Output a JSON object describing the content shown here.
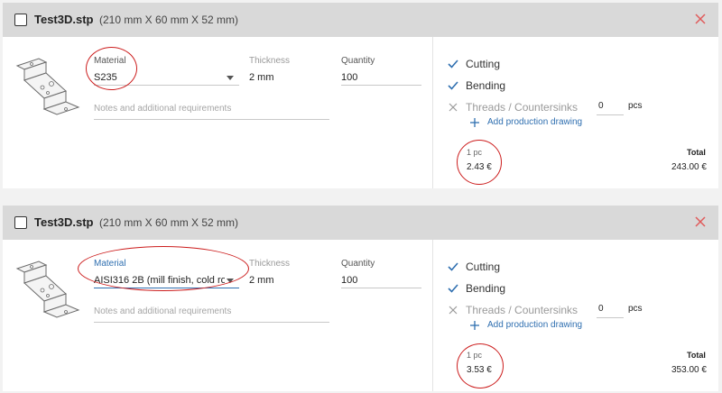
{
  "items": [
    {
      "file_name": "Test3D.stp",
      "dimensions": "(210 mm X 60 mm X 52 mm)",
      "material_label": "Material",
      "material_value": "S235",
      "thickness_label": "Thickness",
      "thickness_value": "2 mm",
      "quantity_label": "Quantity",
      "quantity_value": "100",
      "notes_placeholder": "Notes and additional requirements",
      "options": {
        "cutting": "Cutting",
        "bending": "Bending",
        "threads": "Threads / Countersinks",
        "threads_count": "0",
        "threads_unit": "pcs",
        "add_drawing": "Add production drawing"
      },
      "unit_price_label": "1 pc",
      "unit_price": "2.43 €",
      "total_label": "Total",
      "total_value": "243.00 €"
    },
    {
      "file_name": "Test3D.stp",
      "dimensions": "(210 mm X 60 mm X 52 mm)",
      "material_label": "Material",
      "material_value": "AISI316 2B (mill finish, cold roll",
      "thickness_label": "Thickness",
      "thickness_value": "2 mm",
      "quantity_label": "Quantity",
      "quantity_value": "100",
      "notes_placeholder": "Notes and additional requirements",
      "options": {
        "cutting": "Cutting",
        "bending": "Bending",
        "threads": "Threads / Countersinks",
        "threads_count": "0",
        "threads_unit": "pcs",
        "add_drawing": "Add production drawing"
      },
      "unit_price_label": "1 pc",
      "unit_price": "3.53 €",
      "total_label": "Total",
      "total_value": "353.00 €"
    }
  ],
  "colors": {
    "header_bg": "#d9d9d9",
    "close_icon": "#e05a5a",
    "check_icon": "#2f6fb0",
    "link": "#2f6fb0",
    "annotation": "#cc1d1d"
  },
  "icons": [
    "checkbox",
    "close-icon",
    "part-thumbnail",
    "check-icon",
    "cross-icon",
    "plus-icon",
    "chevron-down-icon"
  ]
}
